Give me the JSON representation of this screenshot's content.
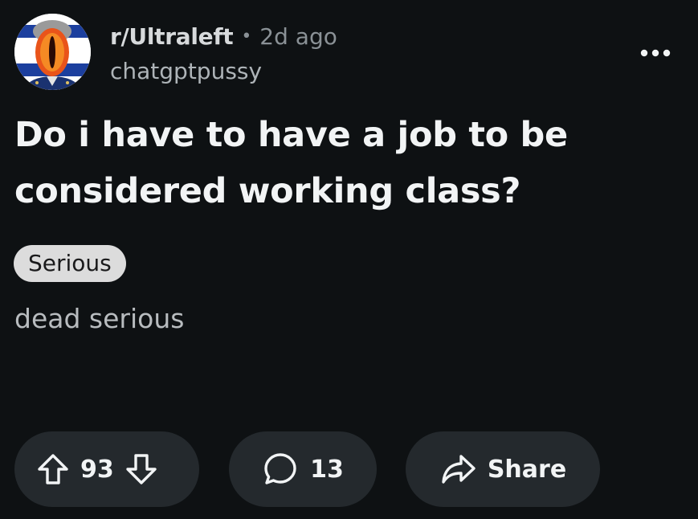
{
  "post": {
    "subreddit": "r/Ultraleft",
    "separator": "•",
    "time_ago": "2d ago",
    "username": "chatgptpussy",
    "title": "Do i have to have a job to be considered working class?",
    "flair": "Serious",
    "body": "dead serious",
    "overflow_icon": "more-horizontal-icon"
  },
  "actions": {
    "vote_count": "93",
    "upvote_icon": "arrow-up-icon",
    "downvote_icon": "arrow-down-icon",
    "comment_count": "13",
    "comment_icon": "speech-bubble-icon",
    "share_label": "Share",
    "share_icon": "share-arrow-icon"
  },
  "colors": {
    "background": "#0e1113",
    "pill_background": "#24292d",
    "flair_background": "#dcdcdc",
    "muted_text": "#8a9196"
  }
}
